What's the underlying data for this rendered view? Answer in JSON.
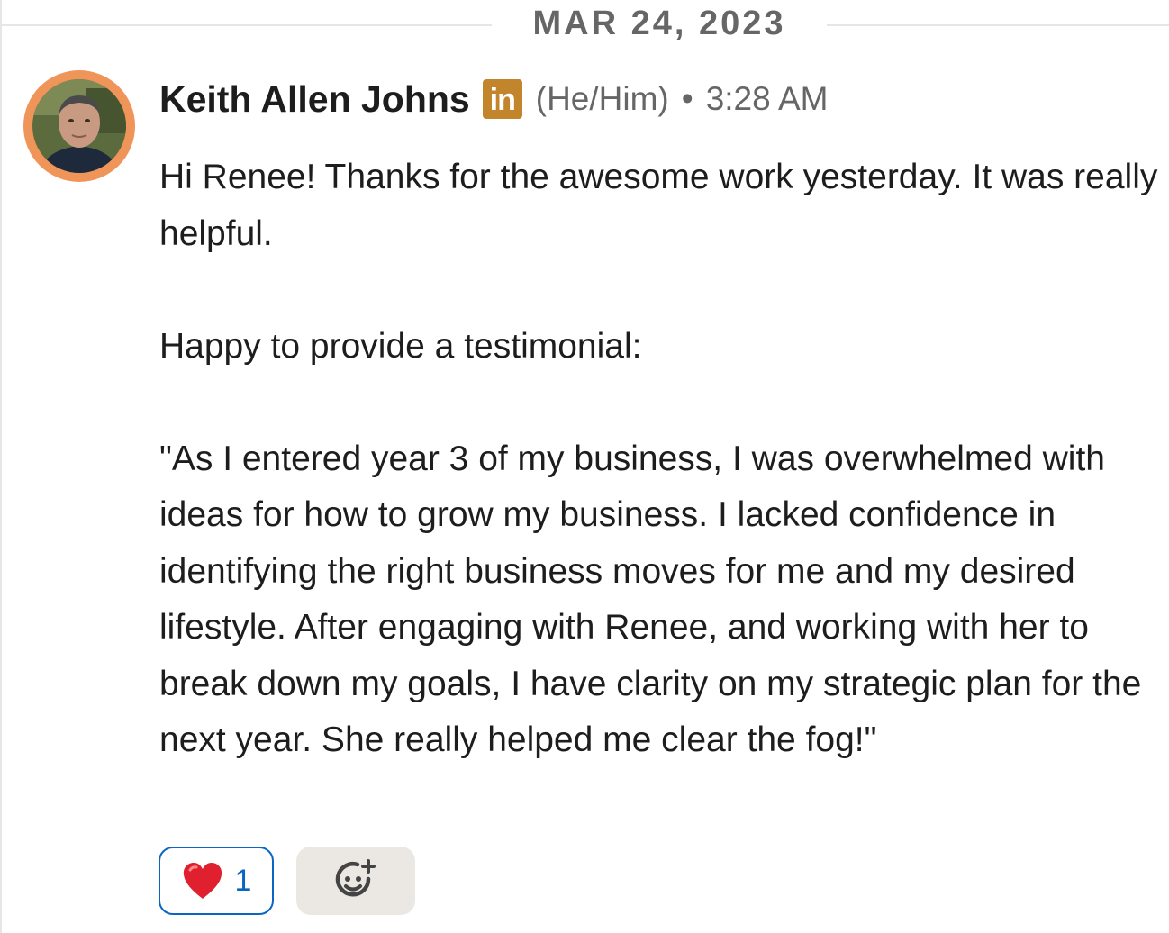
{
  "date_divider": {
    "label": "MAR 24, 2023"
  },
  "message": {
    "sender_name": "Keith Allen Johns",
    "linkedin_badge": "in",
    "pronouns": "(He/Him)",
    "separator": "•",
    "timestamp": "3:28 AM",
    "paragraphs": [
      "Hi Renee! Thanks for the awesome work yesterday. It was really helpful.",
      "Happy to provide a testimonial:",
      "\"As I entered year 3 of my business, I was overwhelmed with ideas for how to grow my business. I lacked confidence in identifying the right business moves for me and my desired lifestyle. After engaging with Renee, and working with her to break down my goals, I have clarity on my strategic plan for the next year. She really helped me clear the fog!\""
    ]
  },
  "reactions": {
    "items": [
      {
        "icon": "red-heart-icon",
        "count": "1"
      }
    ],
    "add_reaction_icon": "add-reaction-icon"
  },
  "colors": {
    "avatar_ring": "#f0955a",
    "linkedin_badge": "#c2852b",
    "reaction_border": "#0a66c2",
    "add_reaction_bg": "#ebe8e3",
    "muted_text": "#666666",
    "body_text": "#1d1d1d"
  }
}
